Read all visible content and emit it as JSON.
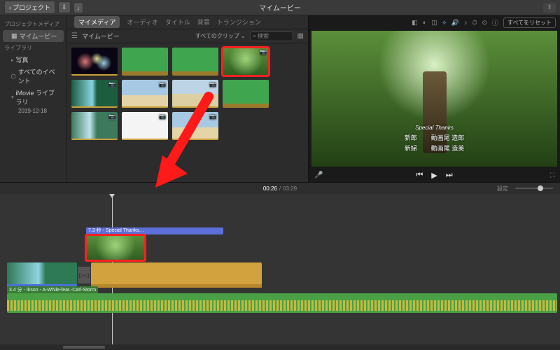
{
  "topbar": {
    "back_label": "プロジェクト",
    "title": "マイムービー",
    "reset_label": "すべてをリセット"
  },
  "sidebar": {
    "header1": "プロジェクトメディア",
    "project": "マイムービー",
    "header2": "ライブラリ",
    "photos": "写真",
    "all_events": "すべてのイベント",
    "library": "iMovie ライブラリ",
    "date": "2019-12-18"
  },
  "media": {
    "tabs": [
      "マイメディア",
      "オーディオ",
      "タイトル",
      "背景",
      "トランジション"
    ],
    "breadcrumb": "マイムービー",
    "filter_label": "すべてのクリップ",
    "search_placeholder": "検索"
  },
  "preview": {
    "overlay_subtitle": "Special Thanks",
    "credit_rows": [
      {
        "role": "新郎",
        "name": "動画尾 造郎"
      },
      {
        "role": "新婦",
        "name": "動画尾 造美"
      }
    ]
  },
  "timeline": {
    "current_time": "00:26",
    "total_time": "03:29",
    "settings_label": "設定",
    "overlay_clip_label": "7.3 秒 - Special Thanks…",
    "audio_clip_label": "3.4 分 - Ikson - A-While-feat.-Carl-Storm"
  }
}
